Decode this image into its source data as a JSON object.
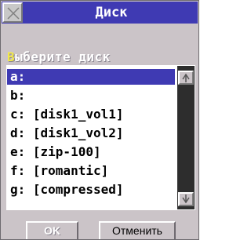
{
  "window": {
    "title": "Диск"
  },
  "prompt": {
    "hotkey": "В",
    "rest": "ыберите диск"
  },
  "drives": [
    {
      "label": "a:",
      "selected": true
    },
    {
      "label": "b:",
      "selected": false
    },
    {
      "label": "c: [disk1_vol1]",
      "selected": false
    },
    {
      "label": "d: [disk1_vol2]",
      "selected": false
    },
    {
      "label": "e: [zip-100]",
      "selected": false
    },
    {
      "label": "f: [romantic]",
      "selected": false
    },
    {
      "label": "g: [compressed]",
      "selected": false
    }
  ],
  "buttons": {
    "ok": "OK",
    "cancel": "Отменить"
  },
  "colors": {
    "titlebar": "#3f3ab3",
    "selection": "#3f3ab3",
    "dialog_bg": "#cbc4c8",
    "hotkey": "#f2e84b"
  },
  "icons": {
    "close": "close-x-icon",
    "scroll_up": "arrow-up-icon",
    "scroll_down": "arrow-down-icon"
  }
}
